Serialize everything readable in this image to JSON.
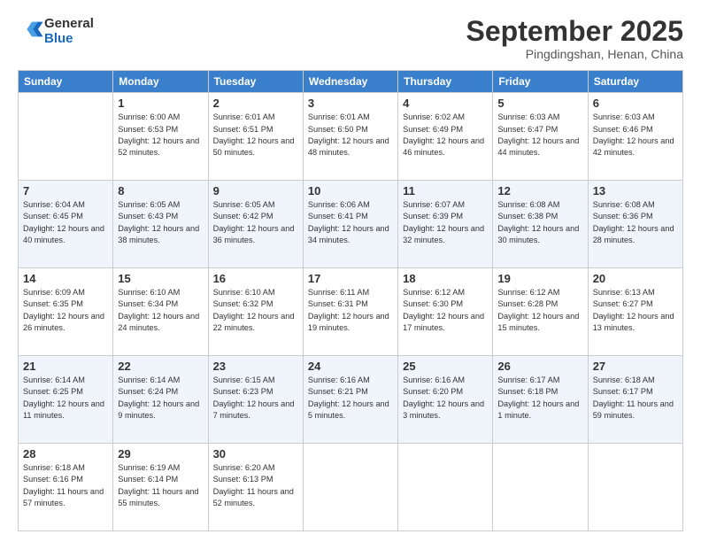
{
  "header": {
    "logo_line1": "General",
    "logo_line2": "Blue",
    "month": "September 2025",
    "location": "Pingdingshan, Henan, China"
  },
  "days_of_week": [
    "Sunday",
    "Monday",
    "Tuesday",
    "Wednesday",
    "Thursday",
    "Friday",
    "Saturday"
  ],
  "weeks": [
    [
      {
        "day": "",
        "sunrise": "",
        "sunset": "",
        "daylight": ""
      },
      {
        "day": "1",
        "sunrise": "Sunrise: 6:00 AM",
        "sunset": "Sunset: 6:53 PM",
        "daylight": "Daylight: 12 hours and 52 minutes."
      },
      {
        "day": "2",
        "sunrise": "Sunrise: 6:01 AM",
        "sunset": "Sunset: 6:51 PM",
        "daylight": "Daylight: 12 hours and 50 minutes."
      },
      {
        "day": "3",
        "sunrise": "Sunrise: 6:01 AM",
        "sunset": "Sunset: 6:50 PM",
        "daylight": "Daylight: 12 hours and 48 minutes."
      },
      {
        "day": "4",
        "sunrise": "Sunrise: 6:02 AM",
        "sunset": "Sunset: 6:49 PM",
        "daylight": "Daylight: 12 hours and 46 minutes."
      },
      {
        "day": "5",
        "sunrise": "Sunrise: 6:03 AM",
        "sunset": "Sunset: 6:47 PM",
        "daylight": "Daylight: 12 hours and 44 minutes."
      },
      {
        "day": "6",
        "sunrise": "Sunrise: 6:03 AM",
        "sunset": "Sunset: 6:46 PM",
        "daylight": "Daylight: 12 hours and 42 minutes."
      }
    ],
    [
      {
        "day": "7",
        "sunrise": "Sunrise: 6:04 AM",
        "sunset": "Sunset: 6:45 PM",
        "daylight": "Daylight: 12 hours and 40 minutes."
      },
      {
        "day": "8",
        "sunrise": "Sunrise: 6:05 AM",
        "sunset": "Sunset: 6:43 PM",
        "daylight": "Daylight: 12 hours and 38 minutes."
      },
      {
        "day": "9",
        "sunrise": "Sunrise: 6:05 AM",
        "sunset": "Sunset: 6:42 PM",
        "daylight": "Daylight: 12 hours and 36 minutes."
      },
      {
        "day": "10",
        "sunrise": "Sunrise: 6:06 AM",
        "sunset": "Sunset: 6:41 PM",
        "daylight": "Daylight: 12 hours and 34 minutes."
      },
      {
        "day": "11",
        "sunrise": "Sunrise: 6:07 AM",
        "sunset": "Sunset: 6:39 PM",
        "daylight": "Daylight: 12 hours and 32 minutes."
      },
      {
        "day": "12",
        "sunrise": "Sunrise: 6:08 AM",
        "sunset": "Sunset: 6:38 PM",
        "daylight": "Daylight: 12 hours and 30 minutes."
      },
      {
        "day": "13",
        "sunrise": "Sunrise: 6:08 AM",
        "sunset": "Sunset: 6:36 PM",
        "daylight": "Daylight: 12 hours and 28 minutes."
      }
    ],
    [
      {
        "day": "14",
        "sunrise": "Sunrise: 6:09 AM",
        "sunset": "Sunset: 6:35 PM",
        "daylight": "Daylight: 12 hours and 26 minutes."
      },
      {
        "day": "15",
        "sunrise": "Sunrise: 6:10 AM",
        "sunset": "Sunset: 6:34 PM",
        "daylight": "Daylight: 12 hours and 24 minutes."
      },
      {
        "day": "16",
        "sunrise": "Sunrise: 6:10 AM",
        "sunset": "Sunset: 6:32 PM",
        "daylight": "Daylight: 12 hours and 22 minutes."
      },
      {
        "day": "17",
        "sunrise": "Sunrise: 6:11 AM",
        "sunset": "Sunset: 6:31 PM",
        "daylight": "Daylight: 12 hours and 19 minutes."
      },
      {
        "day": "18",
        "sunrise": "Sunrise: 6:12 AM",
        "sunset": "Sunset: 6:30 PM",
        "daylight": "Daylight: 12 hours and 17 minutes."
      },
      {
        "day": "19",
        "sunrise": "Sunrise: 6:12 AM",
        "sunset": "Sunset: 6:28 PM",
        "daylight": "Daylight: 12 hours and 15 minutes."
      },
      {
        "day": "20",
        "sunrise": "Sunrise: 6:13 AM",
        "sunset": "Sunset: 6:27 PM",
        "daylight": "Daylight: 12 hours and 13 minutes."
      }
    ],
    [
      {
        "day": "21",
        "sunrise": "Sunrise: 6:14 AM",
        "sunset": "Sunset: 6:25 PM",
        "daylight": "Daylight: 12 hours and 11 minutes."
      },
      {
        "day": "22",
        "sunrise": "Sunrise: 6:14 AM",
        "sunset": "Sunset: 6:24 PM",
        "daylight": "Daylight: 12 hours and 9 minutes."
      },
      {
        "day": "23",
        "sunrise": "Sunrise: 6:15 AM",
        "sunset": "Sunset: 6:23 PM",
        "daylight": "Daylight: 12 hours and 7 minutes."
      },
      {
        "day": "24",
        "sunrise": "Sunrise: 6:16 AM",
        "sunset": "Sunset: 6:21 PM",
        "daylight": "Daylight: 12 hours and 5 minutes."
      },
      {
        "day": "25",
        "sunrise": "Sunrise: 6:16 AM",
        "sunset": "Sunset: 6:20 PM",
        "daylight": "Daylight: 12 hours and 3 minutes."
      },
      {
        "day": "26",
        "sunrise": "Sunrise: 6:17 AM",
        "sunset": "Sunset: 6:18 PM",
        "daylight": "Daylight: 12 hours and 1 minute."
      },
      {
        "day": "27",
        "sunrise": "Sunrise: 6:18 AM",
        "sunset": "Sunset: 6:17 PM",
        "daylight": "Daylight: 11 hours and 59 minutes."
      }
    ],
    [
      {
        "day": "28",
        "sunrise": "Sunrise: 6:18 AM",
        "sunset": "Sunset: 6:16 PM",
        "daylight": "Daylight: 11 hours and 57 minutes."
      },
      {
        "day": "29",
        "sunrise": "Sunrise: 6:19 AM",
        "sunset": "Sunset: 6:14 PM",
        "daylight": "Daylight: 11 hours and 55 minutes."
      },
      {
        "day": "30",
        "sunrise": "Sunrise: 6:20 AM",
        "sunset": "Sunset: 6:13 PM",
        "daylight": "Daylight: 11 hours and 52 minutes."
      },
      {
        "day": "",
        "sunrise": "",
        "sunset": "",
        "daylight": ""
      },
      {
        "day": "",
        "sunrise": "",
        "sunset": "",
        "daylight": ""
      },
      {
        "day": "",
        "sunrise": "",
        "sunset": "",
        "daylight": ""
      },
      {
        "day": "",
        "sunrise": "",
        "sunset": "",
        "daylight": ""
      }
    ]
  ]
}
